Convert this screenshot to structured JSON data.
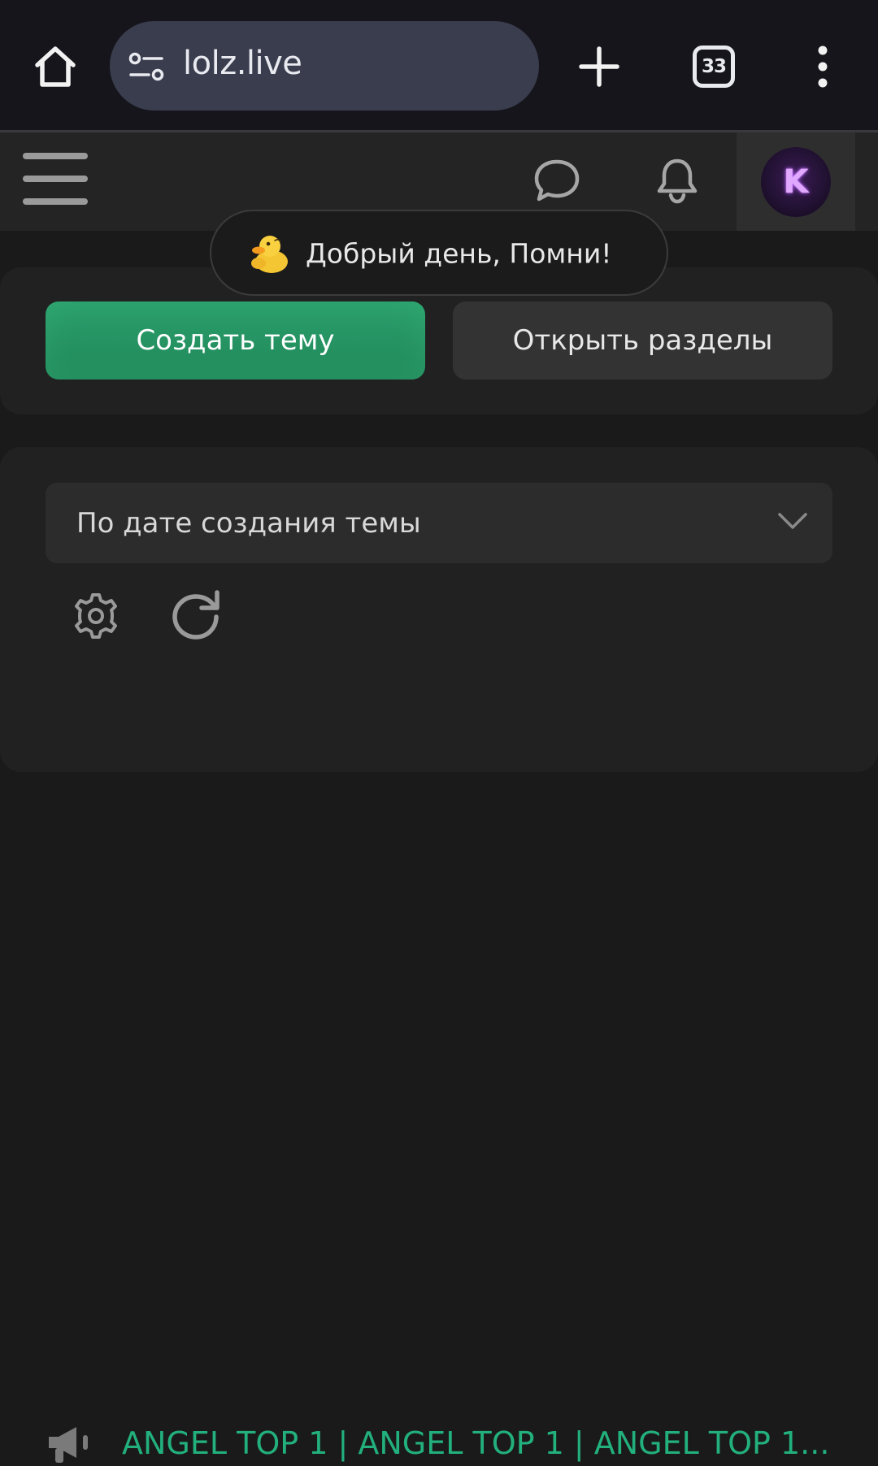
{
  "browser": {
    "url": "lolz.live",
    "tab_count": "33",
    "icons": [
      "home-icon",
      "tune-icon",
      "plus-icon",
      "tabs-icon",
      "more-vert-icon"
    ]
  },
  "header": {
    "icons": [
      "menu-icon",
      "chat-bubble-icon",
      "bell-icon"
    ],
    "avatar_letter": "K"
  },
  "toast": {
    "message": "Добрый день, Помни!",
    "icon": "duck-emoji"
  },
  "actions": {
    "create_label": "Создать тему",
    "sections_label": "Открыть разделы"
  },
  "sort": {
    "selected": "По дате создания темы"
  },
  "toolbar": {
    "icons": [
      "gear-icon",
      "refresh-icon"
    ]
  },
  "threads": [
    {
      "title": "ANGEL TOP 1 | ANGEL TOP 1 | ANGEL TOP 1...",
      "icon": "megaphone-icon"
    }
  ],
  "colors": {
    "accent_green": "#25915f",
    "thread_title": "#22b07d",
    "url_pill": "#3a3d4e"
  }
}
